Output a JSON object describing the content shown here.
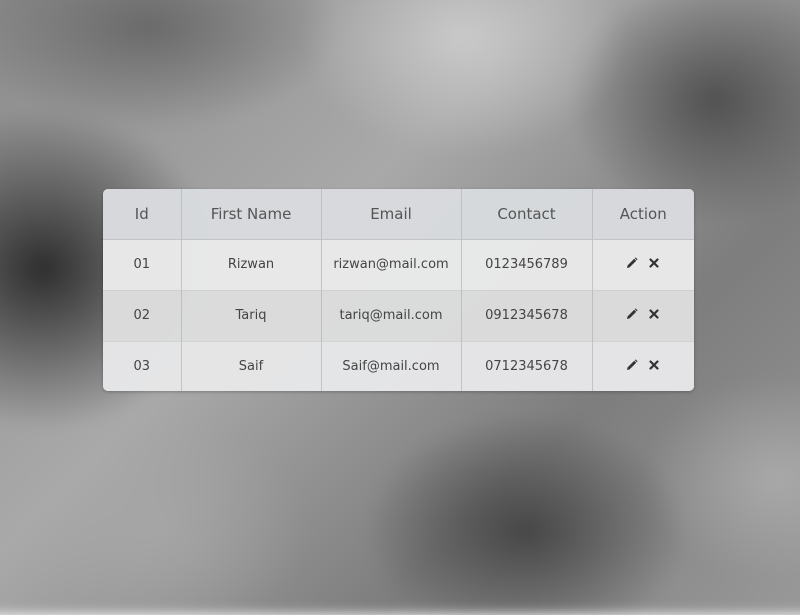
{
  "table": {
    "columns": [
      "Id",
      "First Name",
      "Email",
      "Contact",
      "Action"
    ],
    "rows": [
      {
        "id": "01",
        "first_name": "Rizwan",
        "email": "rizwan@mail.com",
        "contact": "0123456789"
      },
      {
        "id": "02",
        "first_name": "Tariq",
        "email": "tariq@mail.com",
        "contact": "0912345678"
      },
      {
        "id": "03",
        "first_name": "Saif",
        "email": "Saif@mail.com",
        "contact": "0712345678"
      }
    ],
    "action_icons": [
      "pencil-icon",
      "close-icon"
    ]
  },
  "colors": {
    "text": "#444444",
    "header_text": "#555555",
    "icon": "#333333"
  }
}
